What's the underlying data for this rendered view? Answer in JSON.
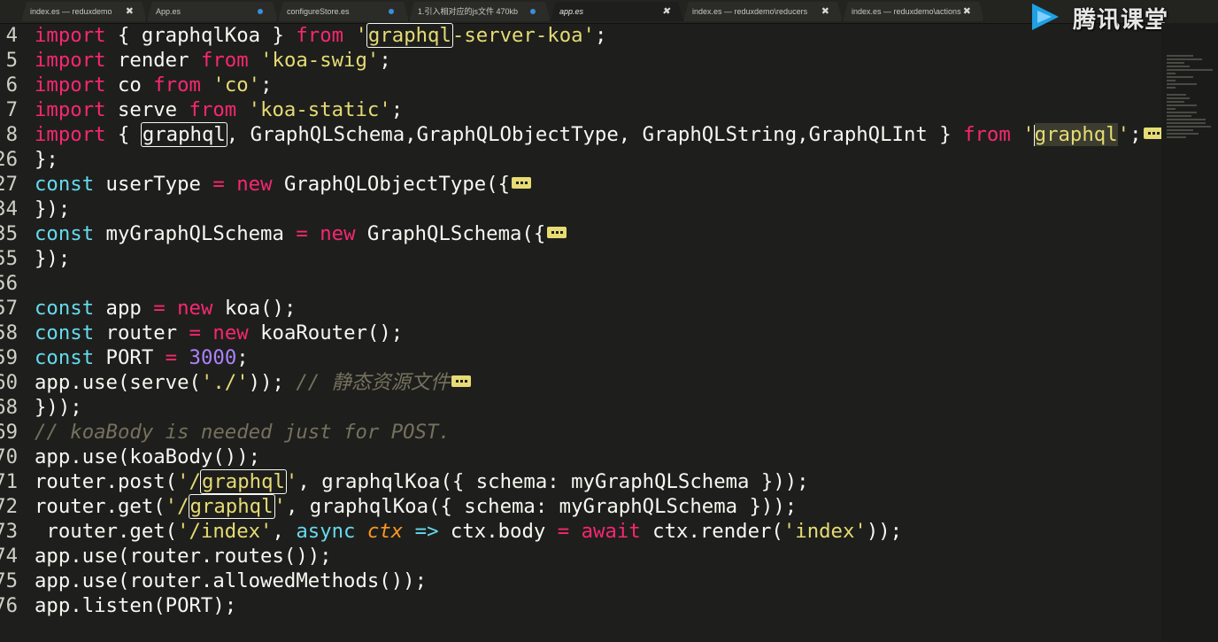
{
  "tabs": [
    {
      "label": "index.es — reduxdemo",
      "indicator": "close",
      "close_glyph": "✖"
    },
    {
      "label": "App.es",
      "indicator": "dirty"
    },
    {
      "label": "configureStore.es",
      "indicator": "dirty"
    },
    {
      "label": "1.引入相对应的js文件 470kb",
      "indicator": "dirty"
    },
    {
      "label": "app.es",
      "indicator": "close",
      "active": true,
      "close_glyph": "✖"
    },
    {
      "label": "index.es — reduxdemo\\reducers",
      "indicator": "close",
      "close_glyph": "✖"
    },
    {
      "label": "index.es — reduxdemo\\actions",
      "indicator": "close",
      "close_glyph": "✖"
    }
  ],
  "watermark": {
    "text": "腾讯课堂",
    "icon": "play-logo-icon"
  },
  "colors": {
    "keyword": "#f92672",
    "string": "#e6db74",
    "number": "#ae81ff",
    "comment": "#75715e",
    "storage": "#66d9ef",
    "param": "#fd971f",
    "background": "#1e1f1c"
  },
  "lines": [
    {
      "n": "4",
      "parts": [
        [
          "kw",
          "import"
        ],
        [
          "",
          " { graphqlKoa } "
        ],
        [
          "kw",
          "from"
        ],
        [
          "",
          " "
        ],
        [
          "str",
          "'"
        ],
        [
          "str hl",
          "graphql"
        ],
        [
          "str",
          "-server-koa'"
        ],
        [
          "",
          ";"
        ]
      ]
    },
    {
      "n": "5",
      "parts": [
        [
          "kw",
          "import"
        ],
        [
          "",
          " render "
        ],
        [
          "kw",
          "from"
        ],
        [
          "",
          " "
        ],
        [
          "str",
          "'koa-swig'"
        ],
        [
          "",
          ";"
        ]
      ]
    },
    {
      "n": "6",
      "parts": [
        [
          "kw",
          "import"
        ],
        [
          "",
          " co "
        ],
        [
          "kw",
          "from"
        ],
        [
          "",
          " "
        ],
        [
          "str",
          "'co'"
        ],
        [
          "",
          ";"
        ]
      ]
    },
    {
      "n": "7",
      "parts": [
        [
          "kw",
          "import"
        ],
        [
          "",
          " serve "
        ],
        [
          "kw",
          "from"
        ],
        [
          "",
          " "
        ],
        [
          "str",
          "'koa-static'"
        ],
        [
          "",
          ";"
        ]
      ]
    },
    {
      "n": "8",
      "parts": [
        [
          "kw",
          "import"
        ],
        [
          "",
          " { "
        ],
        [
          "hl",
          "graphql"
        ],
        [
          "",
          ", GraphQLSchema,GraphQLObjectType, GraphQLString,GraphQLInt } "
        ],
        [
          "kw",
          "from"
        ],
        [
          "",
          " "
        ],
        [
          "str",
          "'"
        ],
        [
          "cursor",
          ""
        ],
        [
          "str sel",
          "graphql"
        ],
        [
          "str",
          "'"
        ],
        [
          "",
          ";"
        ],
        [
          "fold",
          ""
        ]
      ]
    },
    {
      "n": "26",
      "parts": [
        [
          "",
          "};"
        ]
      ]
    },
    {
      "n": "27",
      "parts": [
        [
          "kwb",
          "const"
        ],
        [
          "",
          " userType "
        ],
        [
          "kw",
          "="
        ],
        [
          "",
          " "
        ],
        [
          "kw",
          "new"
        ],
        [
          "",
          " GraphQLObjectType({"
        ],
        [
          "fold",
          ""
        ]
      ]
    },
    {
      "n": "34",
      "parts": [
        [
          "",
          "});"
        ]
      ]
    },
    {
      "n": "35",
      "parts": [
        [
          "kwb",
          "const"
        ],
        [
          "",
          " myGraphQLSchema "
        ],
        [
          "kw",
          "="
        ],
        [
          "",
          " "
        ],
        [
          "kw",
          "new"
        ],
        [
          "",
          " GraphQLSchema({"
        ],
        [
          "fold",
          ""
        ]
      ]
    },
    {
      "n": "55",
      "parts": [
        [
          "",
          "});"
        ]
      ]
    },
    {
      "n": "56",
      "parts": []
    },
    {
      "n": "57",
      "parts": [
        [
          "kwb",
          "const"
        ],
        [
          "",
          " app "
        ],
        [
          "kw",
          "="
        ],
        [
          "",
          " "
        ],
        [
          "kw",
          "new"
        ],
        [
          "",
          " koa();"
        ]
      ]
    },
    {
      "n": "58",
      "parts": [
        [
          "kwb",
          "const"
        ],
        [
          "",
          " router "
        ],
        [
          "kw",
          "="
        ],
        [
          "",
          " "
        ],
        [
          "kw",
          "new"
        ],
        [
          "",
          " koaRouter();"
        ]
      ]
    },
    {
      "n": "59",
      "parts": [
        [
          "kwb",
          "const"
        ],
        [
          "",
          " PORT "
        ],
        [
          "kw",
          "="
        ],
        [
          "",
          " "
        ],
        [
          "num",
          "3000"
        ],
        [
          "",
          ";"
        ]
      ]
    },
    {
      "n": "60",
      "parts": [
        [
          "",
          "app.use(serve("
        ],
        [
          "str",
          "'./'"
        ],
        [
          "",
          "));"
        ],
        [
          "",
          " "
        ],
        [
          "cm",
          "// 静态资源文件"
        ],
        [
          "fold",
          ""
        ]
      ]
    },
    {
      "n": "68",
      "parts": [
        [
          "",
          "}));"
        ]
      ]
    },
    {
      "n": "69",
      "parts": [
        [
          "cm",
          "// koaBody is needed just for POST."
        ]
      ]
    },
    {
      "n": "70",
      "parts": [
        [
          "",
          "app.use(koaBody());"
        ]
      ]
    },
    {
      "n": "71",
      "parts": [
        [
          "",
          "router.post("
        ],
        [
          "str",
          "'/"
        ],
        [
          "str hl",
          "graphql"
        ],
        [
          "str",
          "'"
        ],
        [
          "",
          ", graphqlKoa({ schema: myGraphQLSchema }));"
        ]
      ]
    },
    {
      "n": "72",
      "parts": [
        [
          "",
          "router.get("
        ],
        [
          "str",
          "'/"
        ],
        [
          "str hl",
          "graphql"
        ],
        [
          "str",
          "'"
        ],
        [
          "",
          ", graphqlKoa({ schema: myGraphQLSchema }));"
        ]
      ]
    },
    {
      "n": "73",
      "parts": [
        [
          "",
          " router.get("
        ],
        [
          "str",
          "'/index'"
        ],
        [
          "",
          ", "
        ],
        [
          "kwb",
          "async"
        ],
        [
          "",
          " "
        ],
        [
          "prm",
          "ctx"
        ],
        [
          "",
          " "
        ],
        [
          "kwb",
          "=>"
        ],
        [
          "",
          " ctx.body "
        ],
        [
          "kw",
          "="
        ],
        [
          "",
          " "
        ],
        [
          "kw",
          "await"
        ],
        [
          "",
          " ctx.render("
        ],
        [
          "str",
          "'index'"
        ],
        [
          "",
          "));"
        ]
      ]
    },
    {
      "n": "74",
      "parts": [
        [
          "",
          "app.use(router.routes());"
        ]
      ]
    },
    {
      "n": "75",
      "parts": [
        [
          "",
          "app.use(router.allowedMethods());"
        ]
      ]
    },
    {
      "n": "76",
      "parts": [
        [
          "",
          "app.listen(PORT);"
        ]
      ]
    }
  ]
}
